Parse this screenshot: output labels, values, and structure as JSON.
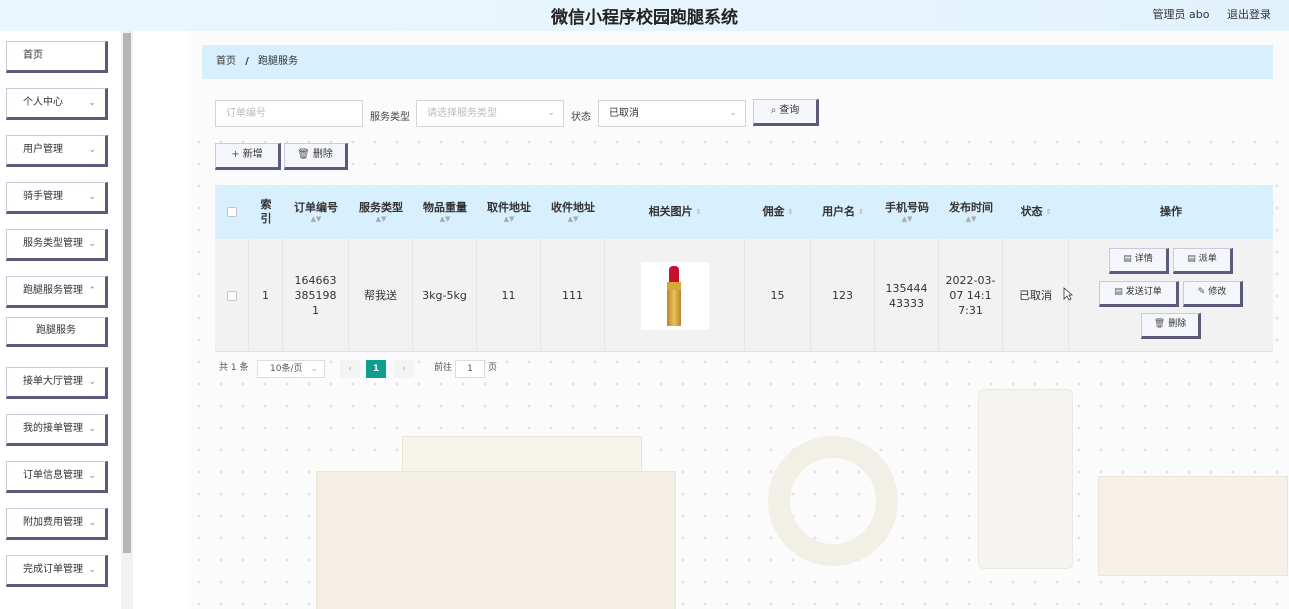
{
  "header": {
    "title": "微信小程序校园跑腿系统",
    "user": "管理员 abo",
    "logout": "退出登录"
  },
  "sidebar": {
    "items": [
      {
        "label": "首页",
        "chev": ""
      },
      {
        "label": "个人中心",
        "chev": "⌄"
      },
      {
        "label": "用户管理",
        "chev": "⌄"
      },
      {
        "label": "骑手管理",
        "chev": "⌄"
      },
      {
        "label": "服务类型管理",
        "chev": "⌄"
      },
      {
        "label": "跑腿服务管理",
        "chev": "⌃"
      },
      {
        "label": "接单大厅管理",
        "chev": "⌄"
      },
      {
        "label": "我的接单管理",
        "chev": "⌄"
      },
      {
        "label": "订单信息管理",
        "chev": "⌄"
      },
      {
        "label": "附加费用管理",
        "chev": "⌄"
      },
      {
        "label": "完成订单管理",
        "chev": "⌄"
      }
    ],
    "sub_item": "跑腿服务"
  },
  "breadcrumb": {
    "home": "首页",
    "sep": "/",
    "current": "跑腿服务"
  },
  "filters": {
    "order_no_placeholder": "订单编号",
    "service_type_label": "服务类型",
    "service_type_placeholder": "请选择服务类型",
    "status_label": "状态",
    "status_value": "已取消",
    "query_label": "查询"
  },
  "toolbar": {
    "add_label": "新增",
    "delete_label": "删除"
  },
  "table": {
    "headers": {
      "index": "索引",
      "order_no": "订单编号",
      "service_type": "服务类型",
      "weight": "物品重量",
      "pickup": "取件地址",
      "delivery": "收件地址",
      "image": "相关图片",
      "commission": "佣金",
      "username": "用户名",
      "phone": "手机号码",
      "publish_time": "发布时间",
      "status": "状态",
      "actions": "操作"
    },
    "rows": [
      {
        "index": "1",
        "order_no": "1646633851981",
        "service_type": "帮我送",
        "weight": "3kg-5kg",
        "pickup": "11",
        "delivery": "111",
        "image": "lipstick",
        "commission": "15",
        "username": "123",
        "phone": "13544443333",
        "publish_time": "2022-03-07 14:17:31",
        "status": "已取消"
      }
    ],
    "row_actions": {
      "detail": "详情",
      "dispatch": "派单",
      "send_order": "发送订单",
      "edit": "修改",
      "delete": "删除"
    }
  },
  "pagination": {
    "total": "共 1 条",
    "page_size": "10条/页",
    "current_page": "1",
    "goto_label": "前往",
    "goto_value": "1",
    "page_suffix": "页"
  },
  "colors": {
    "header_bg": "#d8effd",
    "accent": "#0f9d8e",
    "button_shadow": "#5a5a7c"
  }
}
